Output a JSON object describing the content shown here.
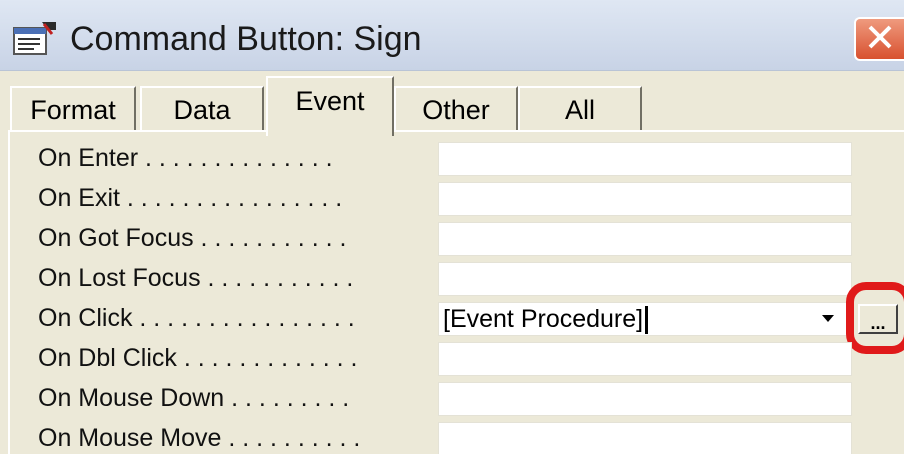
{
  "window": {
    "title": "Command Button: Sign",
    "title_icon": "properties-icon",
    "close_icon": "close-icon",
    "close_color": "#d8512f"
  },
  "tabs": [
    {
      "label": "Format",
      "active": false
    },
    {
      "label": "Data",
      "active": false
    },
    {
      "label": "Event",
      "active": true
    },
    {
      "label": "Other",
      "active": false
    },
    {
      "label": "All",
      "active": false
    }
  ],
  "properties": [
    {
      "label": "On Enter . . . . . . . . . . . . . .",
      "value": ""
    },
    {
      "label": "On Exit . . . . . . . . . . . . . . . .",
      "value": ""
    },
    {
      "label": "On Got Focus . . . . . . . . . . .",
      "value": ""
    },
    {
      "label": "On Lost Focus . . . . . . . . . . .",
      "value": ""
    },
    {
      "label": "On Click . . . . . . . . . . . . . . . .",
      "value": "[Event Procedure]"
    },
    {
      "label": "On Dbl Click . . . . . . . . . . . . .",
      "value": ""
    },
    {
      "label": "On Mouse Down . . . . . . . . .",
      "value": ""
    },
    {
      "label": "On Mouse Move . . . . . . . . . .",
      "value": ""
    }
  ],
  "on_click_row": {
    "dropdown_icon": "dropdown-arrow-icon",
    "builder_label": "...",
    "highlight_color": "#e01a1a"
  }
}
